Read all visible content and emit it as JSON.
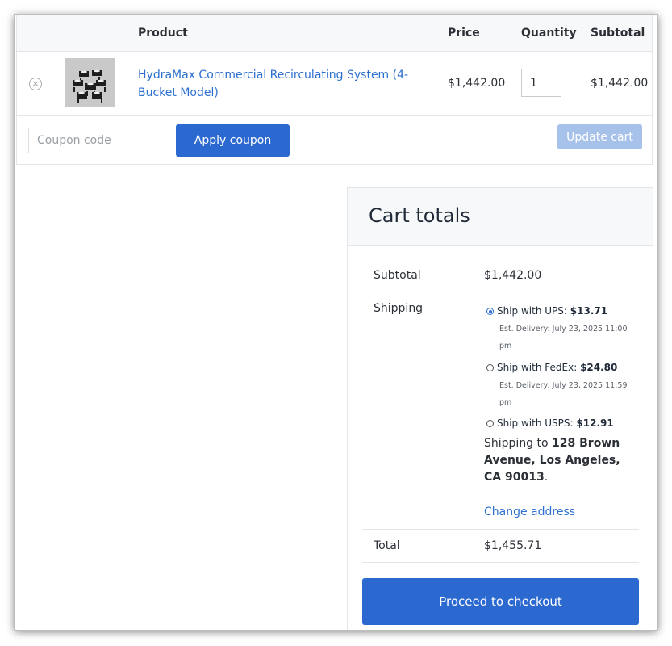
{
  "cart": {
    "headers": {
      "product": "Product",
      "price": "Price",
      "quantity": "Quantity",
      "subtotal": "Subtotal"
    },
    "item": {
      "remove_icon": "close-circle-icon",
      "remove_glyph": "×",
      "name": "HydraMax Commercial Recirculating System (4-Bucket Model)",
      "price": "$1,442.00",
      "quantity": "1",
      "subtotal": "$1,442.00"
    },
    "coupon_placeholder": "Coupon code",
    "apply_label": "Apply coupon",
    "update_label": "Update cart",
    "colors": {
      "primary": "#2b68cf",
      "disabled": "#a7c2ea",
      "link": "#2b6fd1"
    }
  },
  "totals": {
    "title": "Cart totals",
    "subtotal_label": "Subtotal",
    "subtotal_value": "$1,442.00",
    "shipping_label": "Shipping",
    "options": [
      {
        "label": "Ship with UPS:",
        "price": "$13.71",
        "est": "Est. Delivery: July 23, 2025 11:00 pm",
        "selected": true
      },
      {
        "label": "Ship with FedEx:",
        "price": "$24.80",
        "est": "Est. Delivery: July 23, 2025 11:59 pm",
        "selected": false
      },
      {
        "label": "Ship with USPS:",
        "price": "$12.91",
        "est": "",
        "selected": false
      }
    ],
    "ship_to_prefix": "Shipping to ",
    "ship_to_address": "128 Brown Avenue, Los Angeles, CA 90013",
    "ship_to_suffix": ".",
    "change_address": "Change address",
    "total_label": "Total",
    "total_value": "$1,455.71",
    "checkout_label": "Proceed to checkout"
  }
}
